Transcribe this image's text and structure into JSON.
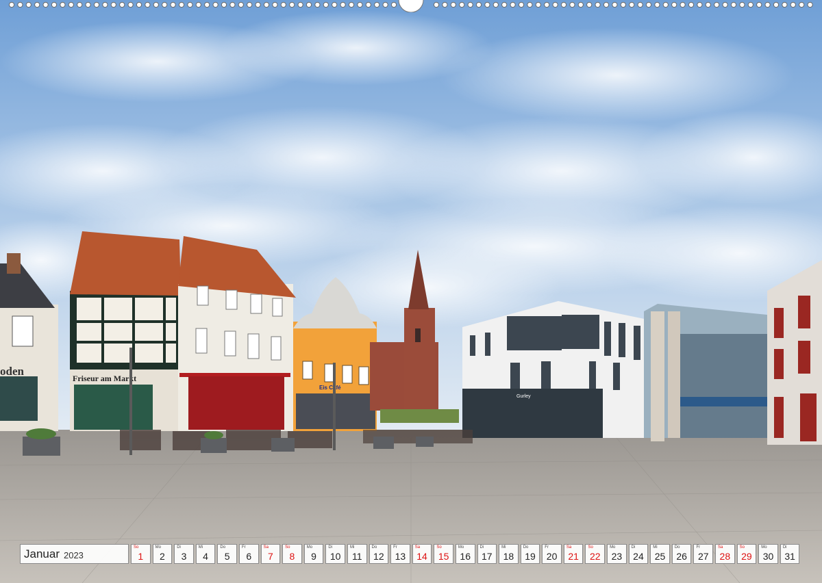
{
  "colors": {
    "accent_weekend": "#d11111",
    "text": "#222222"
  },
  "icons": [
    "binding-rings",
    "binding-hanger"
  ],
  "calendar": {
    "month": "Januar",
    "year": "2023",
    "days": [
      {
        "wd": "So",
        "d": "1",
        "we": true
      },
      {
        "wd": "Mo",
        "d": "2"
      },
      {
        "wd": "Di",
        "d": "3"
      },
      {
        "wd": "Mi",
        "d": "4"
      },
      {
        "wd": "Do",
        "d": "5"
      },
      {
        "wd": "Fr",
        "d": "6"
      },
      {
        "wd": "Sa",
        "d": "7",
        "we": true
      },
      {
        "wd": "So",
        "d": "8",
        "we": true
      },
      {
        "wd": "Mo",
        "d": "9"
      },
      {
        "wd": "Di",
        "d": "10"
      },
      {
        "wd": "Mi",
        "d": "11"
      },
      {
        "wd": "Do",
        "d": "12"
      },
      {
        "wd": "Fr",
        "d": "13"
      },
      {
        "wd": "Sa",
        "d": "14",
        "we": true
      },
      {
        "wd": "So",
        "d": "15",
        "we": true
      },
      {
        "wd": "Mo",
        "d": "16"
      },
      {
        "wd": "Di",
        "d": "17"
      },
      {
        "wd": "Mi",
        "d": "18"
      },
      {
        "wd": "Do",
        "d": "19"
      },
      {
        "wd": "Fr",
        "d": "20"
      },
      {
        "wd": "Sa",
        "d": "21",
        "we": true
      },
      {
        "wd": "So",
        "d": "22",
        "we": true
      },
      {
        "wd": "Mo",
        "d": "23"
      },
      {
        "wd": "Di",
        "d": "24"
      },
      {
        "wd": "Mi",
        "d": "25"
      },
      {
        "wd": "Do",
        "d": "26"
      },
      {
        "wd": "Fr",
        "d": "27"
      },
      {
        "wd": "Sa",
        "d": "28",
        "we": true
      },
      {
        "wd": "So",
        "d": "29",
        "we": true
      },
      {
        "wd": "Mo",
        "d": "30"
      },
      {
        "wd": "Di",
        "d": "31"
      }
    ]
  },
  "signs": {
    "left_edge": "oden",
    "salon": "Friseur am Markt",
    "yellow_house": "Eis Café",
    "modern_building": "Gurley"
  }
}
